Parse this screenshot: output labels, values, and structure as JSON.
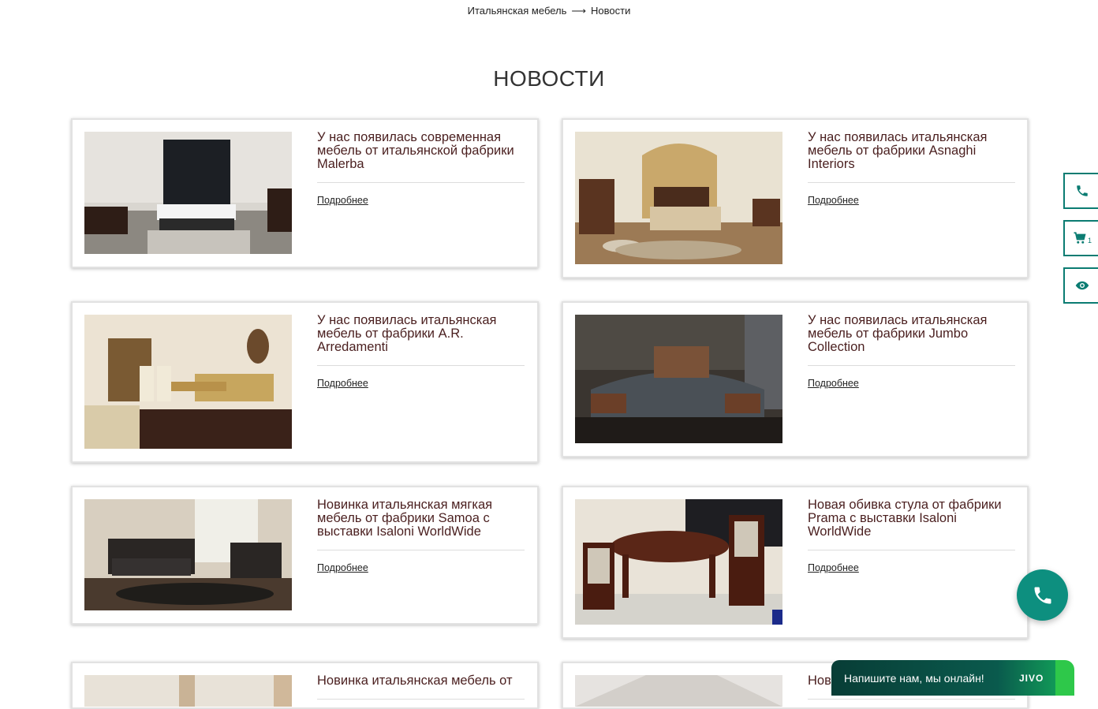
{
  "breadcrumb": {
    "home": "Итальянская мебель",
    "separator": "⟶",
    "current": "Новости"
  },
  "page_title": "НОВОСТИ",
  "more_label": "Подробнее",
  "news": [
    {
      "title": "У нас появилась современная мебель от итальянской фабрики Malerba",
      "image": "modern-bedroom"
    },
    {
      "title": "У нас появилась итальянская мебель от фабрики Asnaghi Interiors",
      "image": "classic-bedroom-canopy"
    },
    {
      "title": "У нас появилась итальянская мебель от фабрики A.R. Arredamenti",
      "image": "classic-dining-room"
    },
    {
      "title": "У нас появилась итальянская мебель от фабрики Jumbo Collection",
      "image": "baroque-bedroom"
    },
    {
      "title": "Новинка итальянская мягкая мебель от фабрики Samoa с выставки Isaloni WorldWide",
      "image": "leather-sofa-set"
    },
    {
      "title": "Новая обивка стула от фабрики Prama с выставки Isaloni WorldWide",
      "image": "dining-table-chairs"
    },
    {
      "title": "Новинка итальянская мебель от",
      "image": "interior-room"
    },
    {
      "title": "Нов",
      "image": "interior-room-2"
    }
  ],
  "side_buttons": [
    {
      "icon": "phone-icon"
    },
    {
      "icon": "cart-icon",
      "count": "1"
    },
    {
      "icon": "eye-icon"
    }
  ],
  "chat": {
    "label": "Напишите нам, мы онлайн!",
    "brand": "JIVO"
  },
  "colors": {
    "accent": "#0b7c72",
    "title": "#4a1f1f",
    "fab": "#0d8f7f"
  }
}
